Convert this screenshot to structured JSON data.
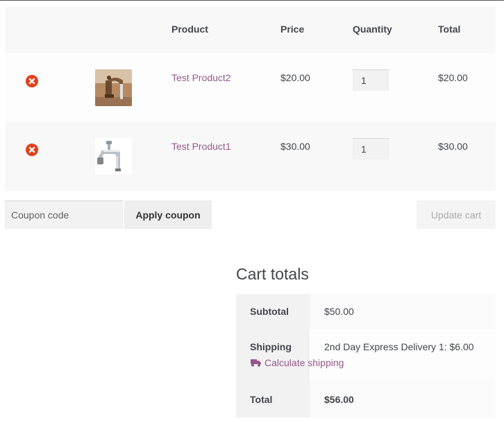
{
  "table": {
    "headers": {
      "product": "Product",
      "price": "Price",
      "quantity": "Quantity",
      "total": "Total"
    },
    "rows": [
      {
        "name": "Test Product2",
        "price": "$20.00",
        "quantity": "1",
        "total": "$20.00",
        "thumb": "brass-faucet-image"
      },
      {
        "name": "Test Product1",
        "price": "$30.00",
        "quantity": "1",
        "total": "$30.00",
        "thumb": "chrome-tap-image"
      }
    ]
  },
  "actions": {
    "coupon_placeholder": "Coupon code",
    "apply_label": "Apply coupon",
    "update_label": "Update cart"
  },
  "totals": {
    "title": "Cart totals",
    "subtotal_label": "Subtotal",
    "subtotal": "$50.00",
    "shipping_label": "Shipping",
    "shipping_method": "2nd Day Express Delivery 1: $6.00",
    "calc_shipping": "Calculate shipping",
    "total_label": "Total",
    "total": "$56.00"
  },
  "colors": {
    "accent": "#96588a",
    "remove": "#e2401c",
    "text": "#43454b"
  }
}
